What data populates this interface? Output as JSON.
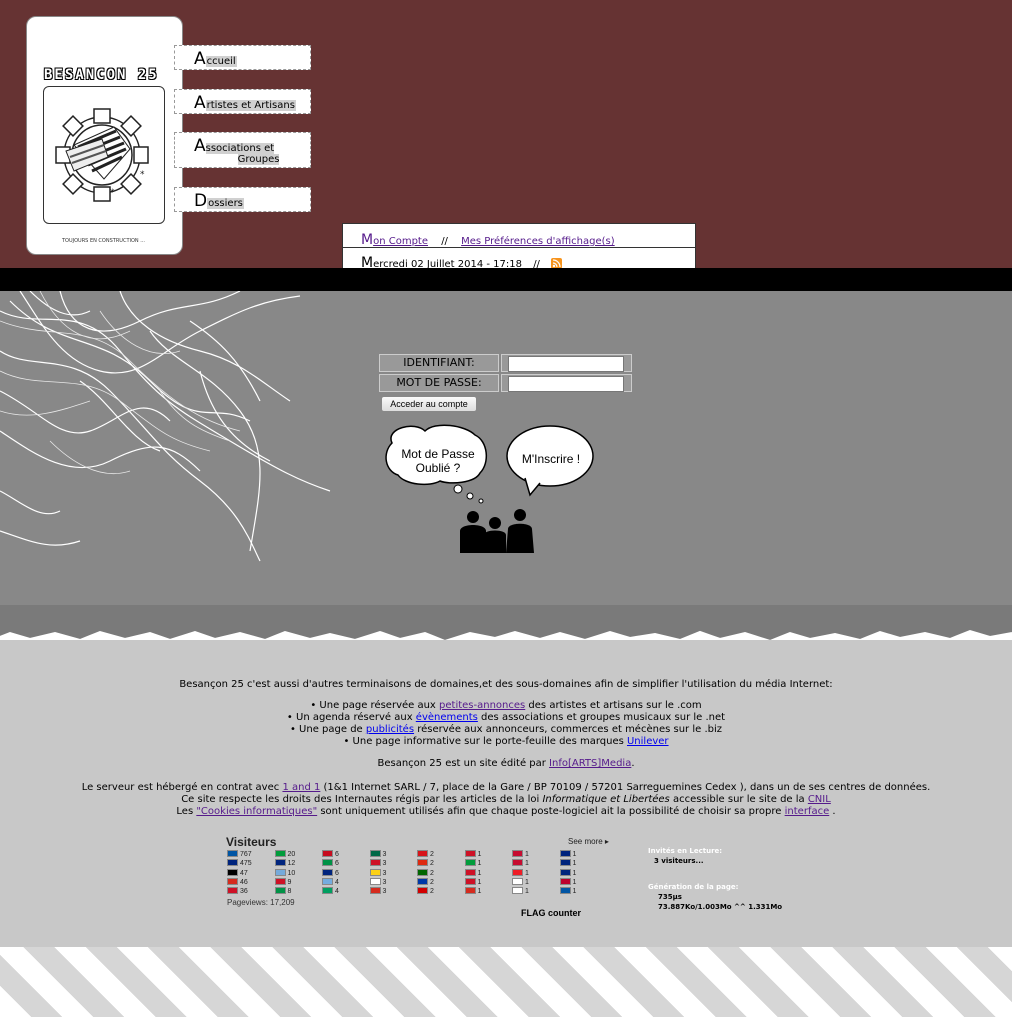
{
  "header": {
    "logo_title": "BESANCON 25",
    "logo_footer": "TOUJOURS EN CONSTRUCTION ...",
    "nav": [
      {
        "initial": "A",
        "rest": "ccueil"
      },
      {
        "initial": "A",
        "rest": "rtistes et Artisans"
      },
      {
        "initial": "A",
        "rest": "ssociations et",
        "rest2": "Groupes"
      },
      {
        "initial": "D",
        "rest": "ossiers"
      }
    ],
    "userbar": {
      "account_initial": "M",
      "account_rest": "on Compte",
      "sep1": "//",
      "prefs_label": "Mes Préférences d'affichage(s)",
      "date_initial": "M",
      "date_rest": "ercredi 02 Juillet 2014 - 17:18",
      "sep2": "//"
    }
  },
  "login": {
    "identifiant_label": "IDENTIFIANT:",
    "password_label": "MOT DE PASSE:",
    "identifiant_value": "",
    "password_value": "",
    "submit_label": "Acceder au compte",
    "forgot_line1": "Mot de Passe",
    "forgot_line2": "Oublié ?",
    "register_label": "M'Inscrire !"
  },
  "footer": {
    "intro": "Besançon 25 c'est aussi d'autres terminaisons de domaines,et des sous-domaines afin de simplifier l'utilisation du média Internet:",
    "line1_pre": "• Une page réservée aux ",
    "line1_link": "petites-annonces",
    "line1_post": " des artistes et artisans sur le .com",
    "line2_pre": "• Un agenda réservé aux ",
    "line2_link": "évènements",
    "line2_post": " des associations et groupes musicaux sur le .net",
    "line3_pre": "• Une page de ",
    "line3_link": "publicités",
    "line3_post": " réservée aux annonceurs, commerces et mécènes sur le .biz",
    "line4_pre": "• Une page informative sur le porte-feuille des marques ",
    "line4_link": "Unilever",
    "editor_pre": "Besançon 25 est un site édité par ",
    "editor_link": "Info[ARTS]Media",
    "editor_post": ".",
    "host_pre": "Le serveur est hébergé en contrat avec ",
    "host_link": "1 and 1",
    "host_post": " (1&1 Internet SARL / 7, place de la Gare / BP 70109 / 57201 Sarreguemines Cedex ), dans un de ses centres de données.",
    "cnil_pre": "Ce site respecte les droits des Internautes régis par les articles de la loi ",
    "cnil_em": "Informatique et Libertées",
    "cnil_mid": " accessible sur le site de la ",
    "cnil_link": "CNIL",
    "cookies_pre": "Les ",
    "cookies_link": "\"Cookies informatiques\"",
    "cookies_mid": " sont uniquement utilisés afin que chaque poste-logiciel ait la possibilité de choisir sa propre ",
    "cookies_link2": "interface",
    "cookies_post": " ."
  },
  "visitors": {
    "title": "Visiteurs",
    "see_more": "See more ▸",
    "pageviews": "Pageviews: 17,209",
    "flag_counter": "FLAG counter",
    "columns": [
      [
        "767",
        "475",
        "47",
        "46",
        "36"
      ],
      [
        "20",
        "12",
        "10",
        "9",
        "8"
      ],
      [
        "6",
        "6",
        "6",
        "4",
        "4"
      ],
      [
        "3",
        "3",
        "3",
        "3",
        "3"
      ],
      [
        "2",
        "2",
        "2",
        "2",
        "2"
      ],
      [
        "1",
        "1",
        "1",
        "1",
        "1"
      ],
      [
        "1",
        "1",
        "1",
        "1",
        "1"
      ],
      [
        "1",
        "1",
        "1",
        "1",
        "1"
      ]
    ]
  },
  "stats": {
    "guests_label": "Invités en Lecture:",
    "guests_value": "3 visiteurs...",
    "gen_label": "Génération de la page:",
    "gen_time": "735µs",
    "gen_mem": "73.887Ko/1.003Mo ^^ 1.331Mo"
  }
}
